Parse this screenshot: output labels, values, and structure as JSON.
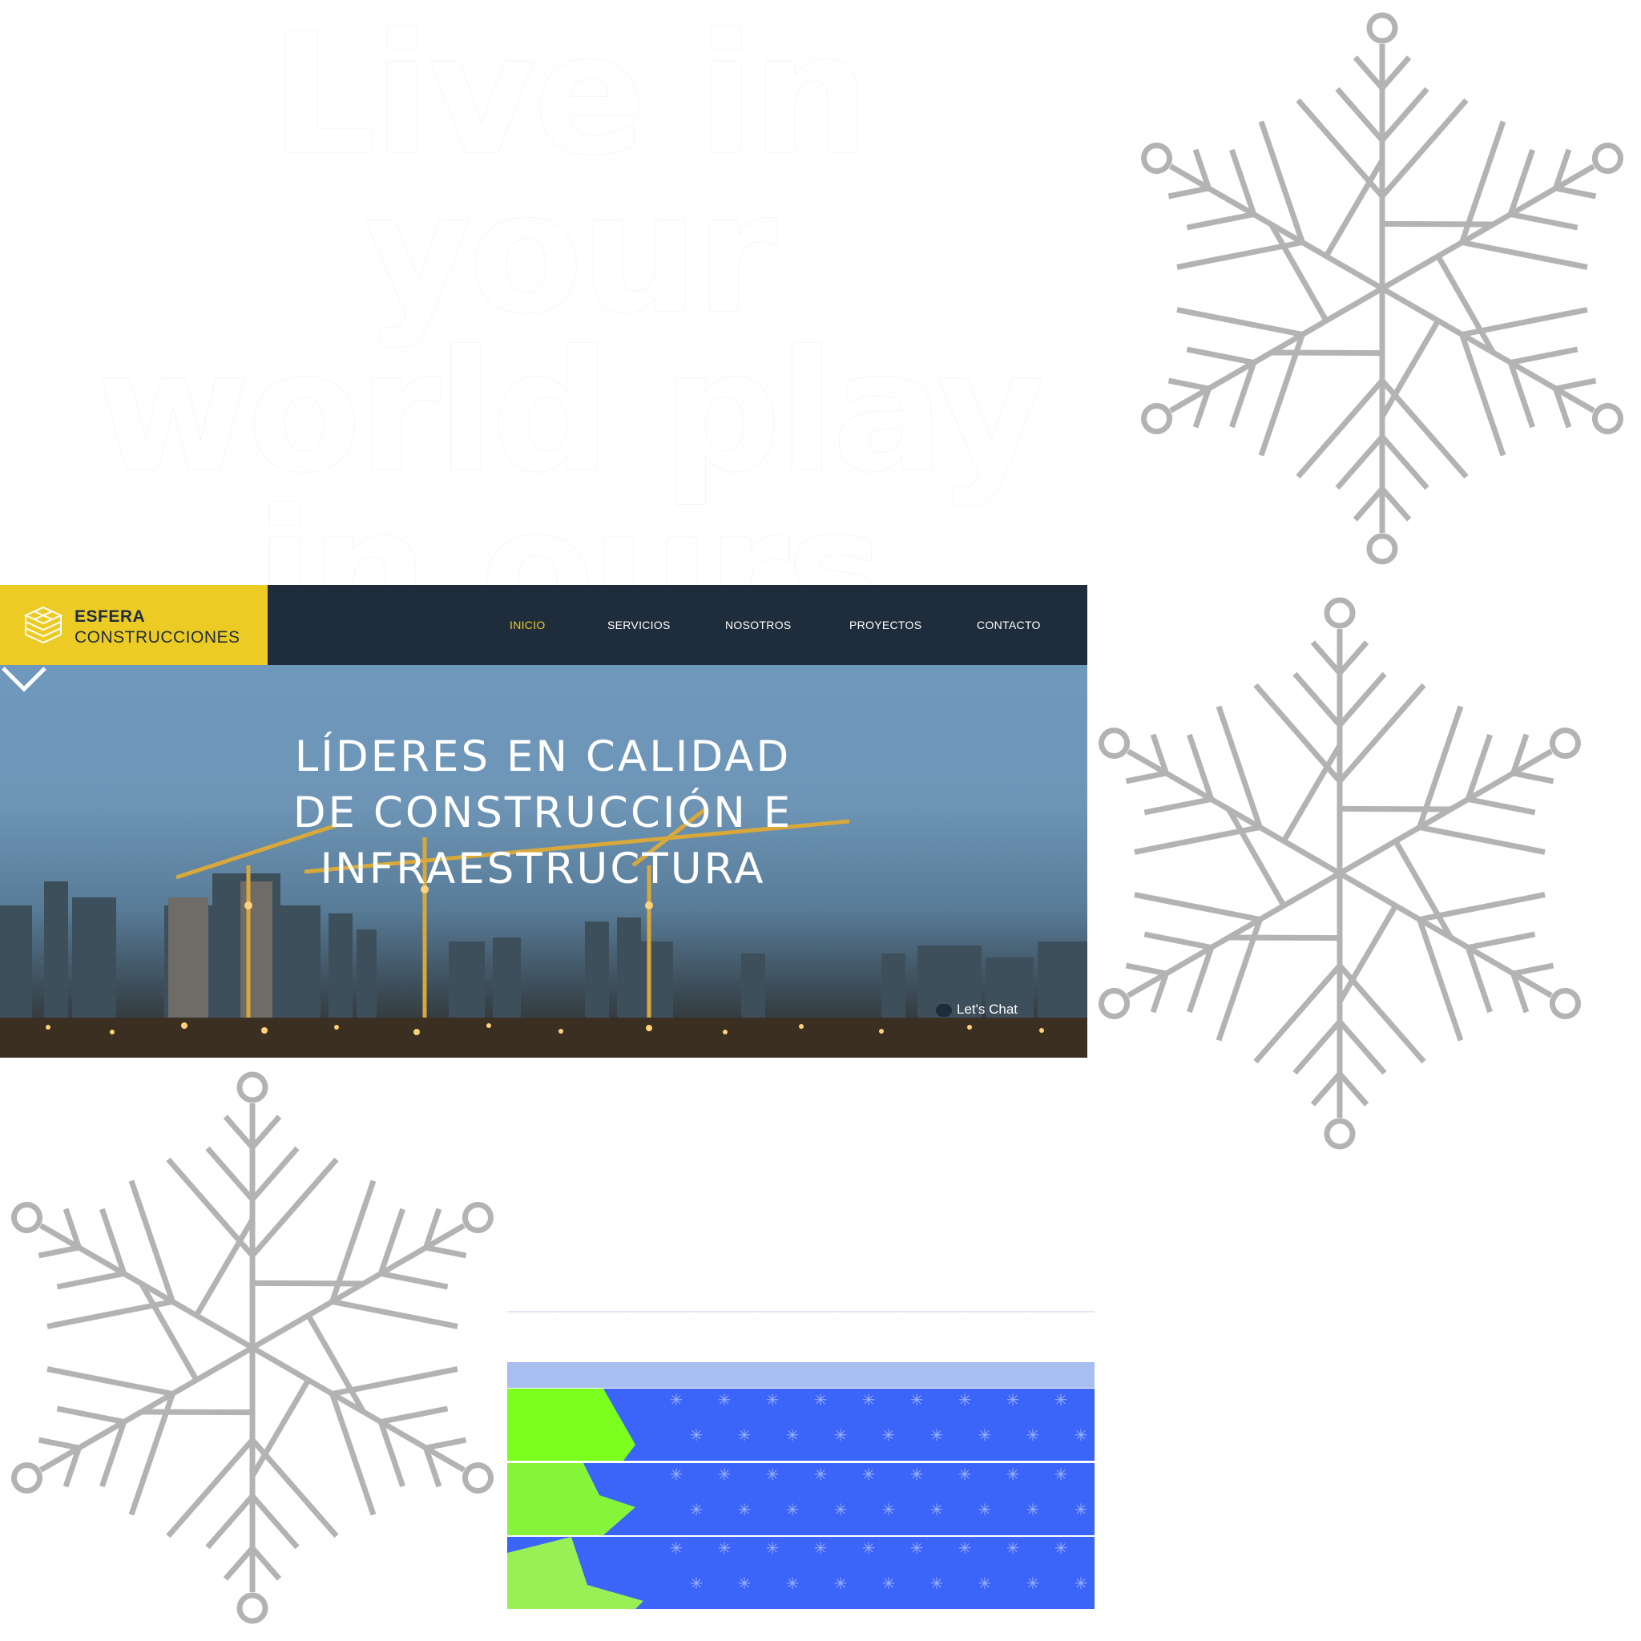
{
  "overlay": {
    "title": "Live in your world play in ours"
  },
  "site": {
    "brand": {
      "name": "ESFERA",
      "sub": "CONSTRUCCIONES"
    },
    "nav": [
      {
        "label": "INICIO",
        "active": true
      },
      {
        "label": "SERVICIOS",
        "active": false
      },
      {
        "label": "NOSOTROS",
        "active": false
      },
      {
        "label": "PROYECTOS",
        "active": false
      },
      {
        "label": "CONTACTO",
        "active": false
      }
    ],
    "hero": {
      "line1": "LÍDERES EN CALIDAD",
      "line2": "DE CONSTRUCCIÓN E",
      "line3": "INFRAESTRUCTURA"
    },
    "chat": "Let's Chat"
  },
  "colors": {
    "accent": "#eccc24",
    "nav_bg": "#1f2c3b",
    "snowflake": "#b3b3b3",
    "row_blue": "#3b64f8",
    "row_green": "#7cff1e"
  },
  "icons": [
    "snowflake-icon",
    "logo-cube-icon",
    "chevron-down-icon",
    "chat-icon"
  ]
}
